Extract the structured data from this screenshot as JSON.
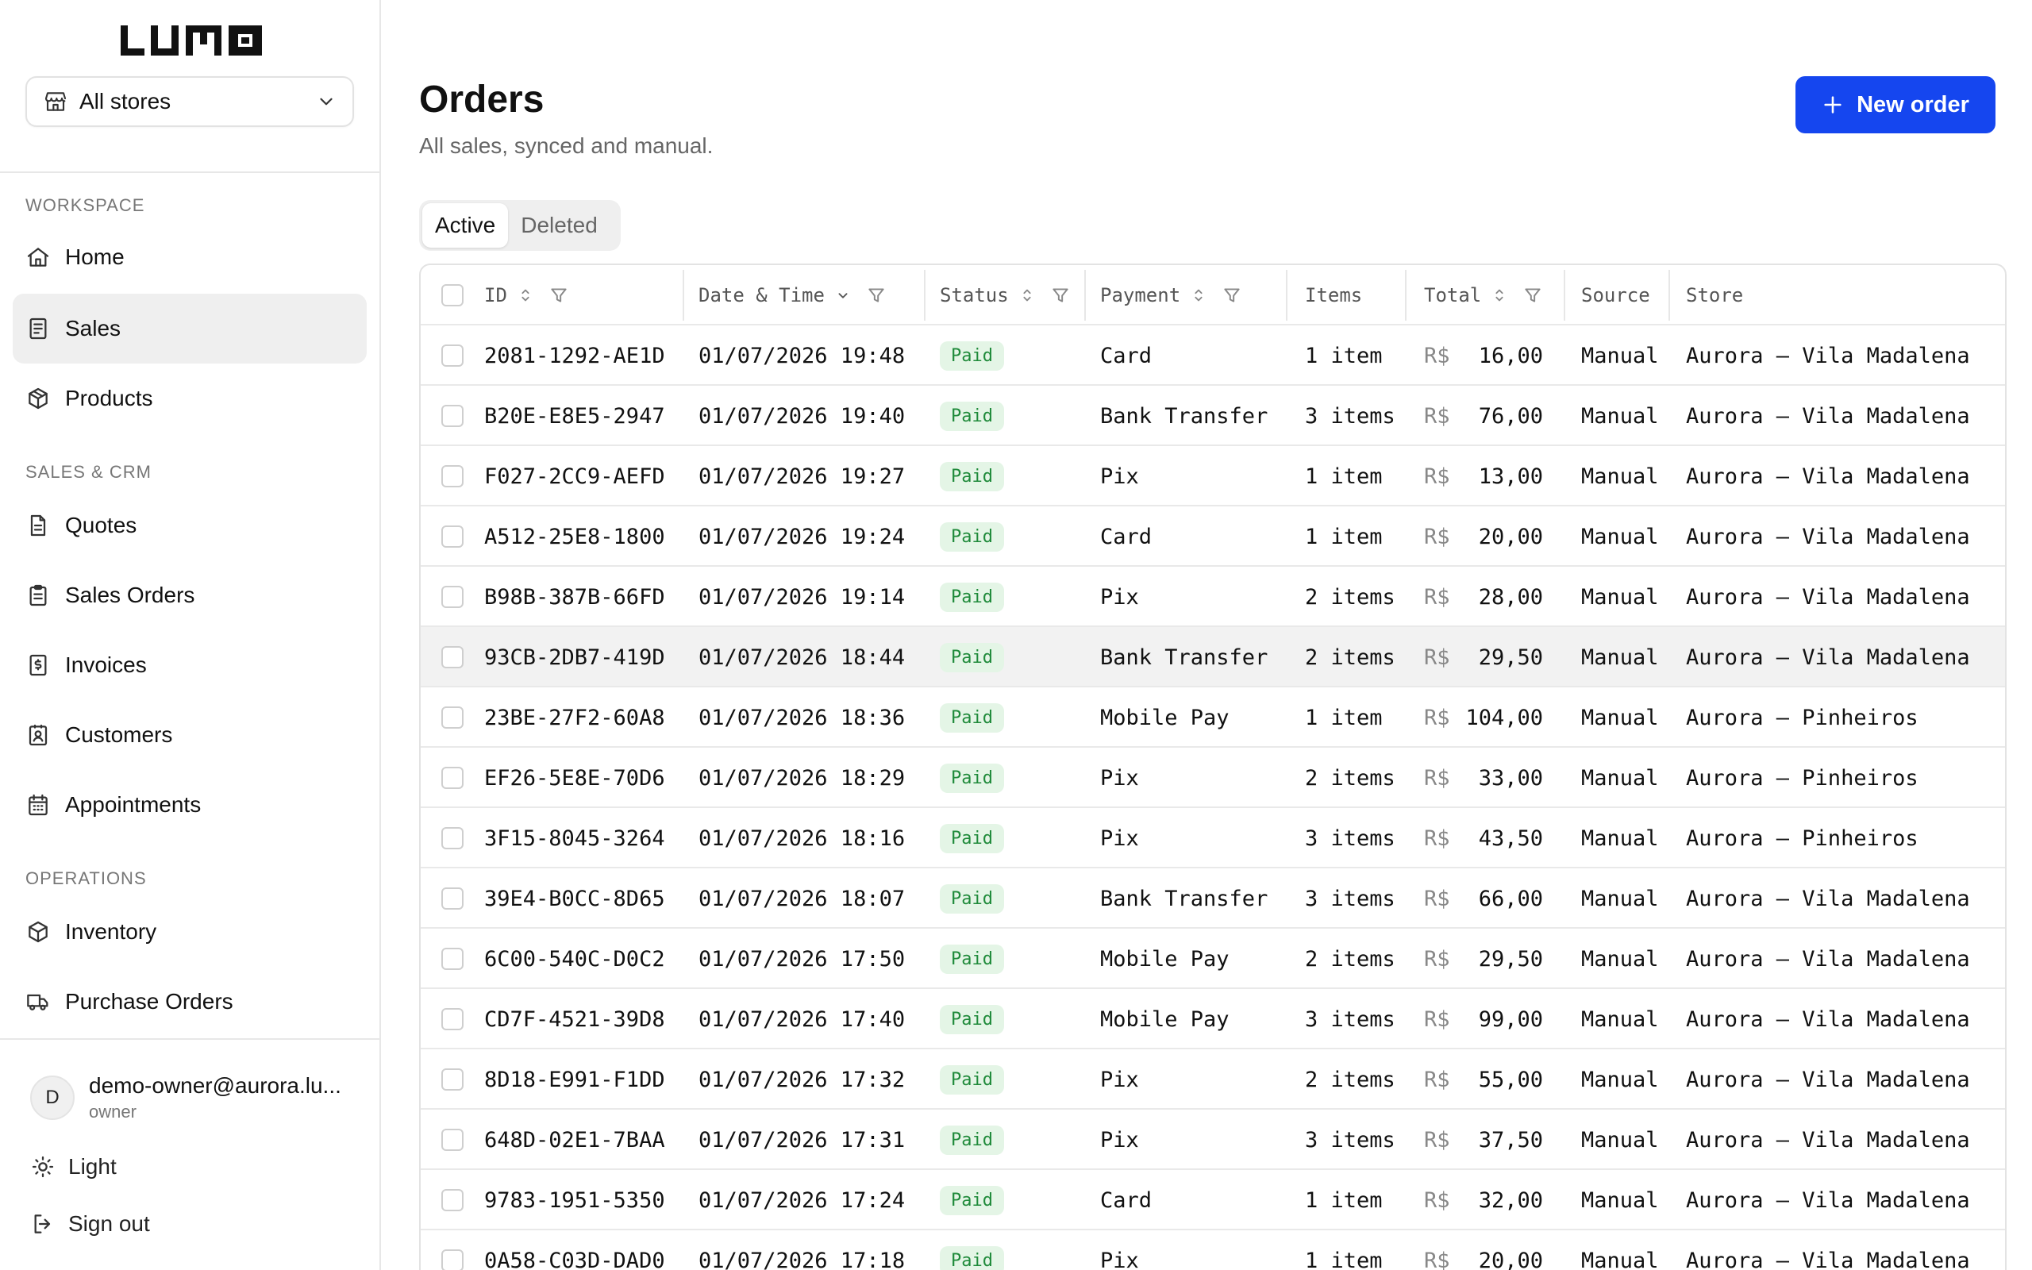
{
  "app": {
    "logo_text": "LUMO"
  },
  "store_select": {
    "value": "All stores"
  },
  "sidebar": {
    "sections": [
      {
        "label": "WORKSPACE"
      },
      {
        "label": "SALES & CRM"
      },
      {
        "label": "OPERATIONS"
      }
    ],
    "items": [
      {
        "label": "Home",
        "icon": "home-icon"
      },
      {
        "label": "Sales",
        "icon": "receipt-icon",
        "active": true
      },
      {
        "label": "Products",
        "icon": "box-icon"
      },
      {
        "label": "Quotes",
        "icon": "document-icon"
      },
      {
        "label": "Sales Orders",
        "icon": "clipboard-icon"
      },
      {
        "label": "Invoices",
        "icon": "invoice-icon"
      },
      {
        "label": "Customers",
        "icon": "contact-icon"
      },
      {
        "label": "Appointments",
        "icon": "calendar-icon"
      },
      {
        "label": "Inventory",
        "icon": "package-icon"
      },
      {
        "label": "Purchase Orders",
        "icon": "truck-icon"
      }
    ]
  },
  "user": {
    "initial": "D",
    "email": "demo-owner@aurora.lu...",
    "role": "owner"
  },
  "footer": {
    "theme_label": "Light",
    "signout_label": "Sign out"
  },
  "header": {
    "title": "Orders",
    "subtitle": "All sales, synced and manual.",
    "new_button": "New order"
  },
  "tabs": [
    {
      "label": "Active",
      "active": true
    },
    {
      "label": "Deleted",
      "active": false
    }
  ],
  "table": {
    "columns": [
      "ID",
      "Date & Time",
      "Status",
      "Payment",
      "Items",
      "Total",
      "Source",
      "Store"
    ],
    "currency": "R$",
    "rows": [
      {
        "id": "2081-1292-AE1D",
        "datetime": "01/07/2026 19:48",
        "status": "Paid",
        "payment": "Card",
        "items": "1 item",
        "total": "16,00",
        "source": "Manual",
        "store": "Aurora — Vila Madalena"
      },
      {
        "id": "B20E-E8E5-2947",
        "datetime": "01/07/2026 19:40",
        "status": "Paid",
        "payment": "Bank Transfer",
        "items": "3 items",
        "total": "76,00",
        "source": "Manual",
        "store": "Aurora — Vila Madalena"
      },
      {
        "id": "F027-2CC9-AEFD",
        "datetime": "01/07/2026 19:27",
        "status": "Paid",
        "payment": "Pix",
        "items": "1 item",
        "total": "13,00",
        "source": "Manual",
        "store": "Aurora — Vila Madalena"
      },
      {
        "id": "A512-25E8-1800",
        "datetime": "01/07/2026 19:24",
        "status": "Paid",
        "payment": "Card",
        "items": "1 item",
        "total": "20,00",
        "source": "Manual",
        "store": "Aurora — Vila Madalena"
      },
      {
        "id": "B98B-387B-66FD",
        "datetime": "01/07/2026 19:14",
        "status": "Paid",
        "payment": "Pix",
        "items": "2 items",
        "total": "28,00",
        "source": "Manual",
        "store": "Aurora — Vila Madalena"
      },
      {
        "id": "93CB-2DB7-419D",
        "datetime": "01/07/2026 18:44",
        "status": "Paid",
        "payment": "Bank Transfer",
        "items": "2 items",
        "total": "29,50",
        "source": "Manual",
        "store": "Aurora — Vila Madalena",
        "hover": true
      },
      {
        "id": "23BE-27F2-60A8",
        "datetime": "01/07/2026 18:36",
        "status": "Paid",
        "payment": "Mobile Pay",
        "items": "1 item",
        "total": "104,00",
        "source": "Manual",
        "store": "Aurora — Pinheiros"
      },
      {
        "id": "EF26-5E8E-70D6",
        "datetime": "01/07/2026 18:29",
        "status": "Paid",
        "payment": "Pix",
        "items": "2 items",
        "total": "33,00",
        "source": "Manual",
        "store": "Aurora — Pinheiros"
      },
      {
        "id": "3F15-8045-3264",
        "datetime": "01/07/2026 18:16",
        "status": "Paid",
        "payment": "Pix",
        "items": "3 items",
        "total": "43,50",
        "source": "Manual",
        "store": "Aurora — Pinheiros"
      },
      {
        "id": "39E4-B0CC-8D65",
        "datetime": "01/07/2026 18:07",
        "status": "Paid",
        "payment": "Bank Transfer",
        "items": "3 items",
        "total": "66,00",
        "source": "Manual",
        "store": "Aurora — Vila Madalena"
      },
      {
        "id": "6C00-540C-D0C2",
        "datetime": "01/07/2026 17:50",
        "status": "Paid",
        "payment": "Mobile Pay",
        "items": "2 items",
        "total": "29,50",
        "source": "Manual",
        "store": "Aurora — Vila Madalena"
      },
      {
        "id": "CD7F-4521-39D8",
        "datetime": "01/07/2026 17:40",
        "status": "Paid",
        "payment": "Mobile Pay",
        "items": "3 items",
        "total": "99,00",
        "source": "Manual",
        "store": "Aurora — Vila Madalena"
      },
      {
        "id": "8D18-E991-F1DD",
        "datetime": "01/07/2026 17:32",
        "status": "Paid",
        "payment": "Pix",
        "items": "2 items",
        "total": "55,00",
        "source": "Manual",
        "store": "Aurora — Vila Madalena"
      },
      {
        "id": "648D-02E1-7BAA",
        "datetime": "01/07/2026 17:31",
        "status": "Paid",
        "payment": "Pix",
        "items": "3 items",
        "total": "37,50",
        "source": "Manual",
        "store": "Aurora — Vila Madalena"
      },
      {
        "id": "9783-1951-5350",
        "datetime": "01/07/2026 17:24",
        "status": "Paid",
        "payment": "Card",
        "items": "1 item",
        "total": "32,00",
        "source": "Manual",
        "store": "Aurora — Vila Madalena"
      },
      {
        "id": "0A58-C03D-DAD0",
        "datetime": "01/07/2026 17:18",
        "status": "Paid",
        "payment": "Pix",
        "items": "1 item",
        "total": "20,00",
        "source": "Manual",
        "store": "Aurora — Vila Madalena"
      }
    ]
  },
  "colors": {
    "accent": "#1546ef",
    "paid_bg": "#e4f5e6",
    "paid_text": "#1f8a3a",
    "active_nav": "#efefef"
  }
}
